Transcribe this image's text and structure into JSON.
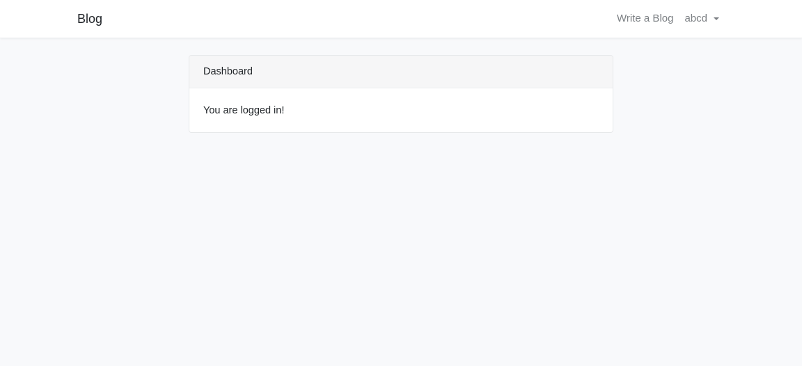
{
  "navbar": {
    "brand": "Blog",
    "links": [
      {
        "label": "Write a Blog"
      },
      {
        "label": "abcd",
        "has_dropdown": true
      }
    ]
  },
  "card": {
    "header": "Dashboard",
    "body": "You are logged in!"
  },
  "colors": {
    "page_background": "#f8f9fb",
    "navbar_background": "#ffffff",
    "card_header_background": "#f6f6f7",
    "nav_link_text": "#7b7f83",
    "text": "#212529"
  }
}
